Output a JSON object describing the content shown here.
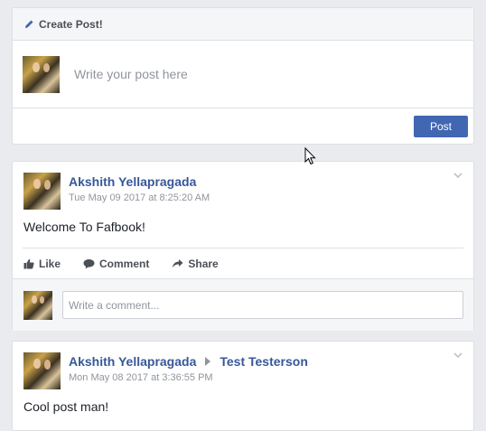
{
  "create_post": {
    "header": "Create Post!",
    "placeholder": "Write your post here",
    "post_button": "Post"
  },
  "posts": [
    {
      "author": "Akshith Yellapragada",
      "recipient": "",
      "timestamp": "Tue May 09 2017 at  8:25:20 AM",
      "text": "Welcome To Fafbook!",
      "actions": {
        "like": "Like",
        "comment": "Comment",
        "share": "Share"
      },
      "comment_placeholder": "Write a comment..."
    },
    {
      "author": "Akshith Yellapragada",
      "recipient": "Test Testerson",
      "timestamp": "Mon May 08 2017 at  3:36:55 PM",
      "text": "Cool post man!"
    }
  ],
  "colors": {
    "link": "#365899",
    "button": "#4267b2",
    "muted": "#90949c",
    "background": "#e9ebee"
  },
  "icons": [
    "pencil-icon",
    "chevron-down-icon",
    "like-icon",
    "comment-icon",
    "share-icon",
    "caret-right-icon",
    "mouse-cursor-icon"
  ]
}
